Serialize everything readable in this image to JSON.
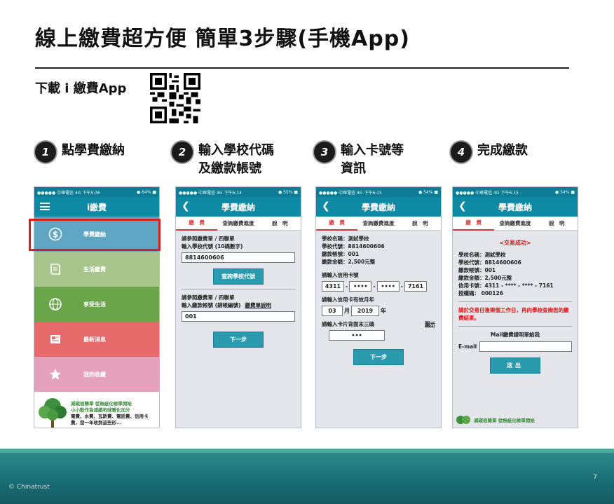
{
  "title": "線上繳費超方便  簡單3步驟(手機App)",
  "download_label": "下載 i 繳費App",
  "steps": [
    {
      "num": "1",
      "text": "點學費繳納"
    },
    {
      "num": "2",
      "text": "輸入學校代碼\n及繳款帳號"
    },
    {
      "num": "3",
      "text": "輸入卡號等\n資訊"
    },
    {
      "num": "4",
      "text": "完成繳款"
    }
  ],
  "phone1": {
    "status_left": "●●●●● 中華電信 4G   下午5:36",
    "status_right": "● 64% ■",
    "app_title": "i繳費",
    "menu": [
      {
        "label": "學費繳納",
        "icon": "dollar-icon",
        "color": "#5fa6c4"
      },
      {
        "label": "生活繳費",
        "icon": "receipt-icon",
        "color": "#a8c58c"
      },
      {
        "label": "享受生活",
        "icon": "globe-icon",
        "color": "#6aa54a"
      },
      {
        "label": "最新消息",
        "icon": "news-icon",
        "color": "#e66a6a"
      },
      {
        "label": "我的收藏",
        "icon": "star-icon",
        "color": "#e6a2bd"
      }
    ],
    "ad_line1": "減碳很簡單 從無紙化帳單開始",
    "ad_line2": "小小動作為減緩地球暖化加分",
    "ad_line3": "電費、水費、瓦斯費、電話費、信用卡費，您一年收到這些形..."
  },
  "phone2": {
    "status_left": "●●●●● 中華電信 4G   下午6:14",
    "status_right": "● 55% ■",
    "nav_title": "學費繳納",
    "tabs": [
      "繳　費",
      "查詢繳費進度",
      "說　明"
    ],
    "label1": "請參照繳費單 / 四聯單",
    "label2": "輸入學校代號 (10碼數字)",
    "school_code": "8814600606",
    "query_btn": "查詢學校代號",
    "label3": "請參照繳費單 / 四聯單",
    "label4": "輸入繳款帳號 (銷帳編號)",
    "bill_link": "繳費單說明",
    "account_no": "001",
    "next_btn": "下一步"
  },
  "phone3": {
    "status_left": "●●●●● 中華電信 4G   下午6:15",
    "status_right": "● 54% ■",
    "nav_title": "學費繳納",
    "tabs": [
      "繳　費",
      "查詢繳費進度",
      "說　明"
    ],
    "info": [
      "學校名稱：測試學校",
      "學校代號：8814600606",
      "繳款帳號：001",
      "繳款金額：2,500元整"
    ],
    "card_label": "請輸入信用卡號",
    "card_parts": [
      "4311",
      "••••",
      "••••",
      "7161"
    ],
    "expiry_label": "請輸入信用卡有效月年",
    "month": "03",
    "month_unit": "月",
    "year": "2019",
    "year_unit": "年",
    "cvv_label": "請輸入卡片背面末三碼",
    "cvv_hint": "圖示",
    "cvv": "•••",
    "next_btn": "下一步"
  },
  "phone4": {
    "status_left": "●●●●● 中華電信 4G   下午6:15",
    "status_right": "● 54% ■",
    "nav_title": "學費繳納",
    "tabs": [
      "繳　費",
      "查詢繳費進度",
      "說　明"
    ],
    "success": "<交易成功>",
    "info": [
      "學校名稱：測試學校",
      "學校代號：8814600606",
      "繳款帳號：001",
      "繳款金額：2,500元整",
      "信用卡號：4311 - **** - **** - 7161",
      "授權碼：  000126"
    ],
    "note": "請於交易日後兩個工作日，再向學校查詢您的繳費結果。",
    "mail_label": "Mail繳費證明單給我",
    "email_label": "E-mail",
    "email_value": "",
    "send_btn": "送出",
    "footer_ad": "減碳很簡單 從無紙化帳單開始"
  },
  "footer": {
    "copyright": "© Chinatrust",
    "page_number": "7"
  }
}
